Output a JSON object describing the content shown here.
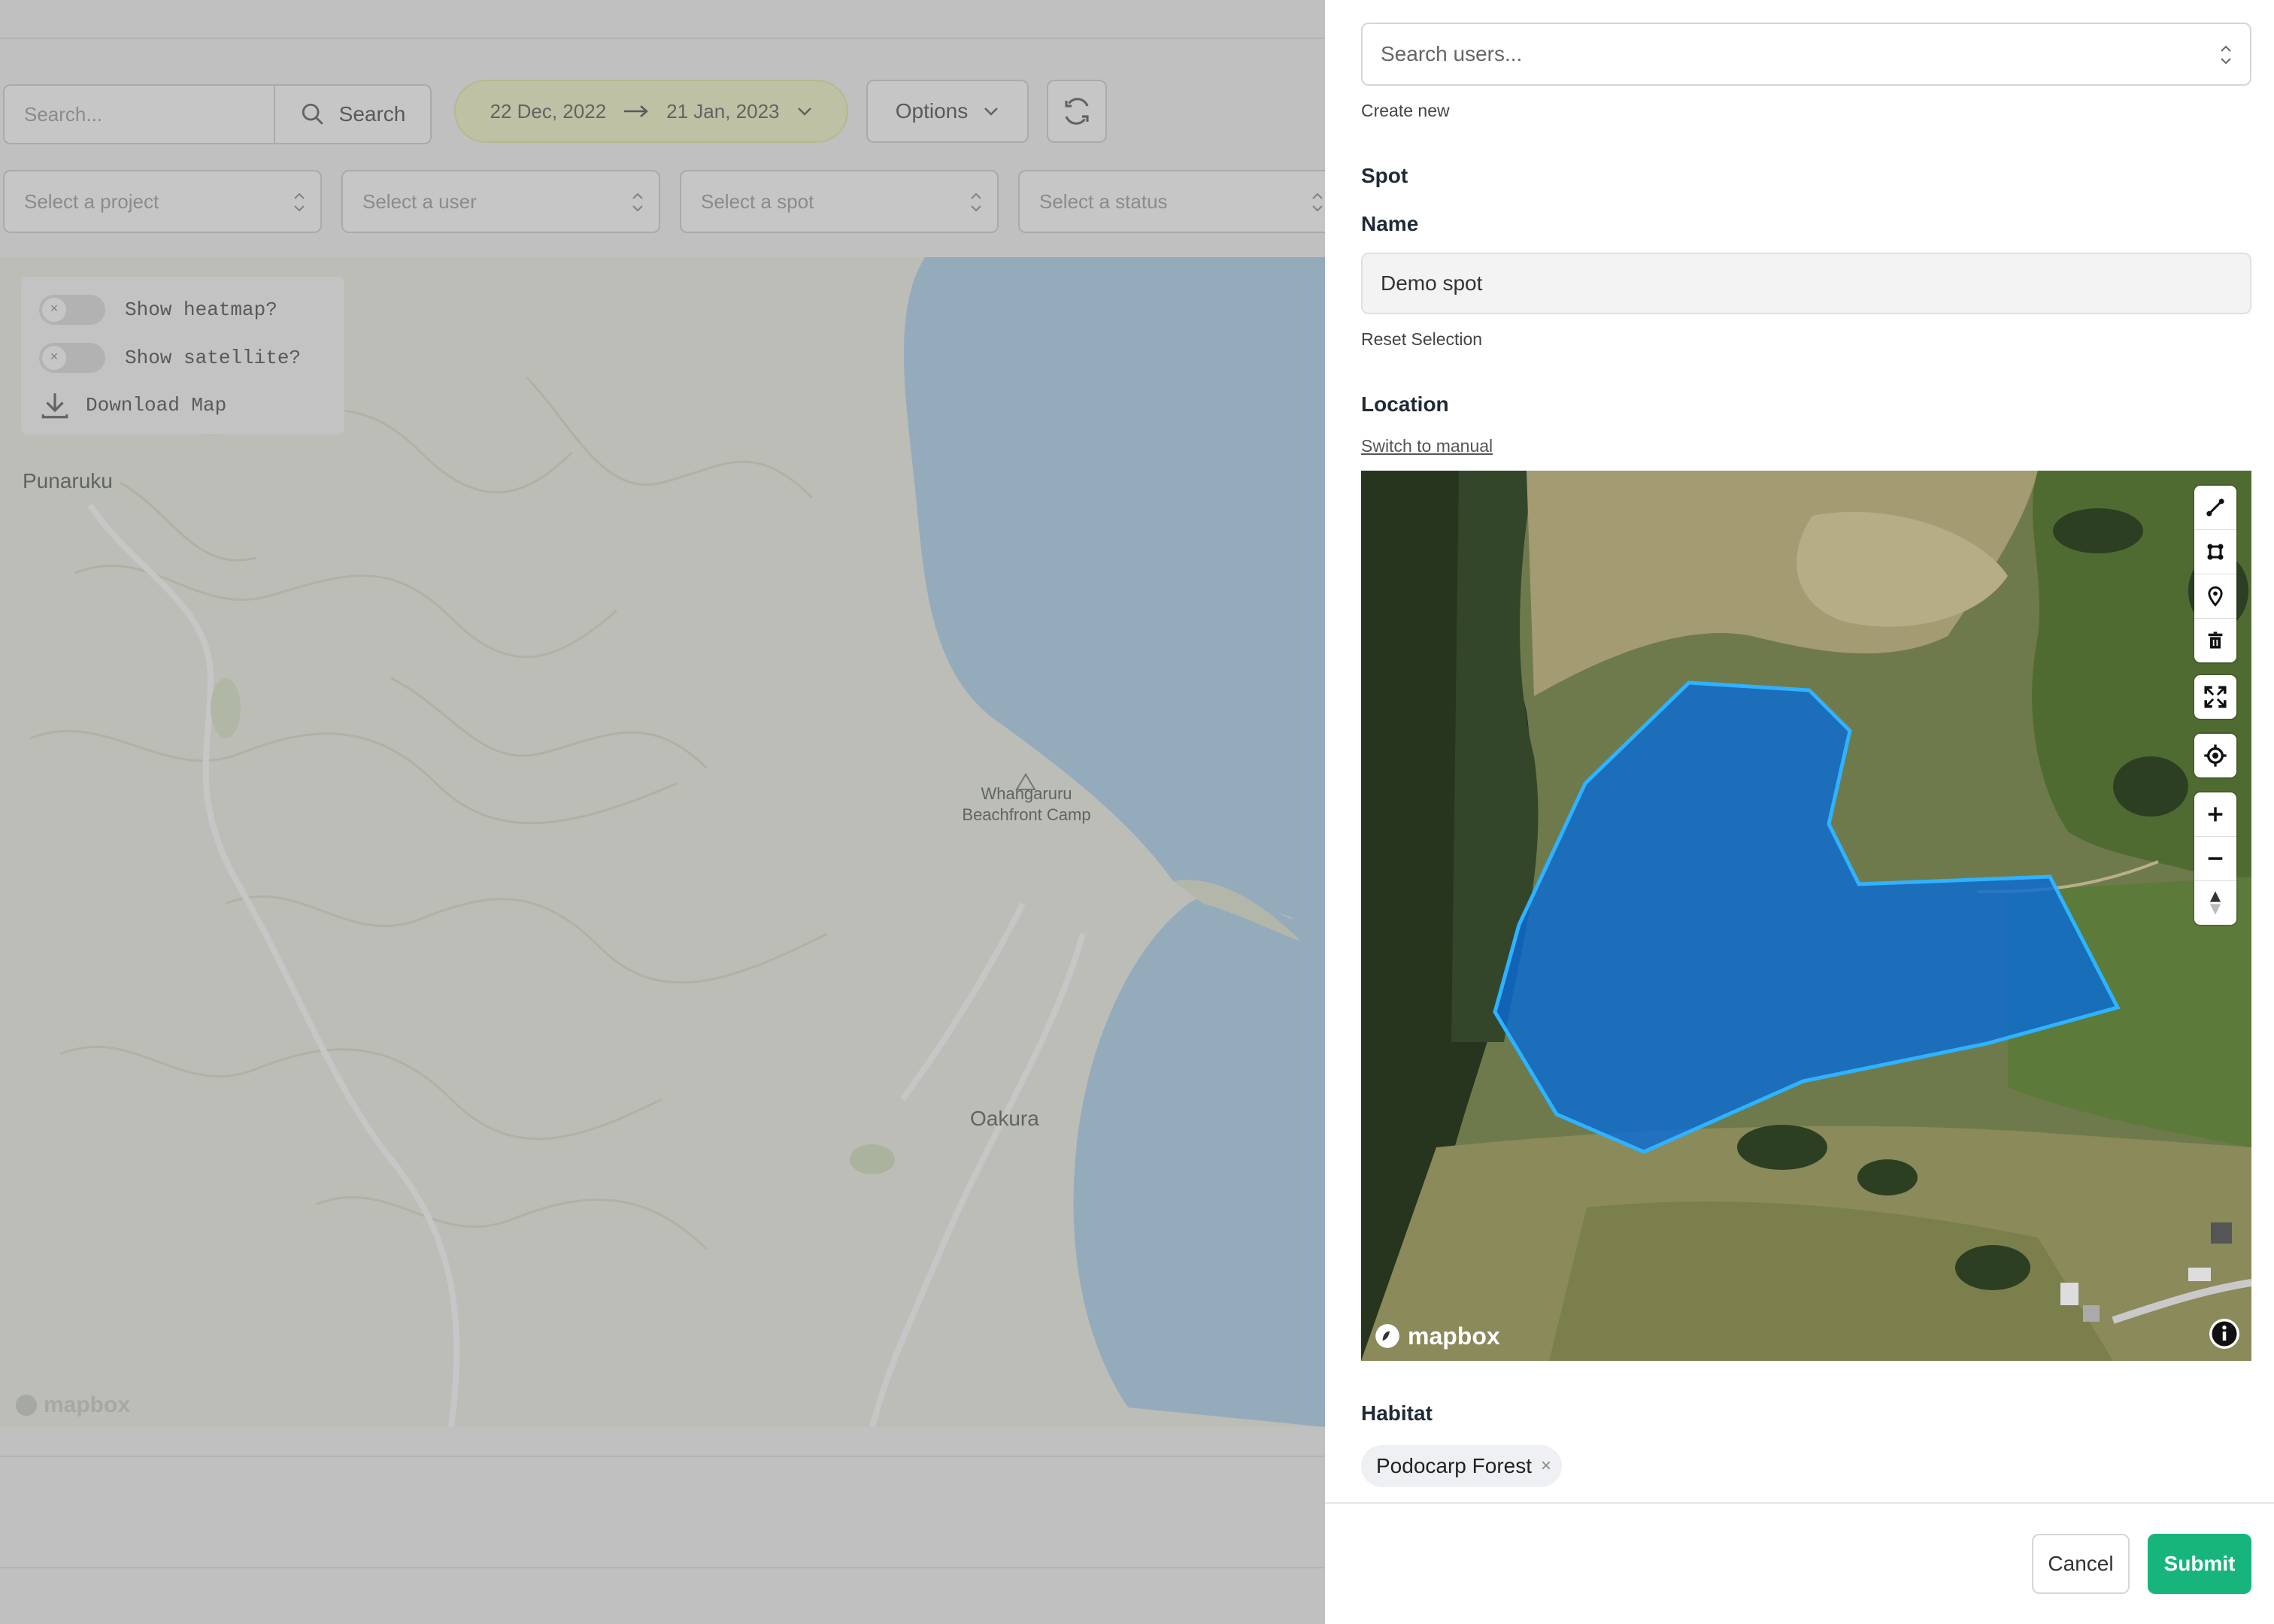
{
  "background": {
    "search": {
      "placeholder": "Search...",
      "button_label": "Search"
    },
    "date_range": {
      "start": "22 Dec, 2022",
      "end": "21 Jan, 2023"
    },
    "options_label": "Options",
    "filters": {
      "project": "Select a project",
      "user": "Select a user",
      "spot": "Select a spot",
      "status": "Select a status"
    },
    "map_controls": {
      "heatmap": "Show heatmap?",
      "satellite": "Show satellite?",
      "download": "Download Map"
    },
    "places": {
      "punaruku": "Punaruku",
      "camp_line1": "Whangaruru",
      "camp_line2": "Beachfront Camp",
      "oakura": "Oakura"
    },
    "map_logo": "mapbox"
  },
  "drawer": {
    "user_search_placeholder": "Search users...",
    "create_new": "Create new",
    "spot_heading": "Spot",
    "name_label": "Name",
    "name_value": "Demo spot",
    "reset_selection": "Reset Selection",
    "location_label": "Location",
    "switch_manual": "Switch to manual",
    "map_logo": "mapbox",
    "habitat_label": "Habitat",
    "habitat_chip": "Podocarp Forest",
    "chip_remove": "×",
    "cancel": "Cancel",
    "submit": "Submit"
  },
  "colors": {
    "accent": "#17b57c",
    "polygon_fill": "#0a6bd4",
    "polygon_stroke": "#2fb2ff",
    "water": "#a9d1ec"
  }
}
